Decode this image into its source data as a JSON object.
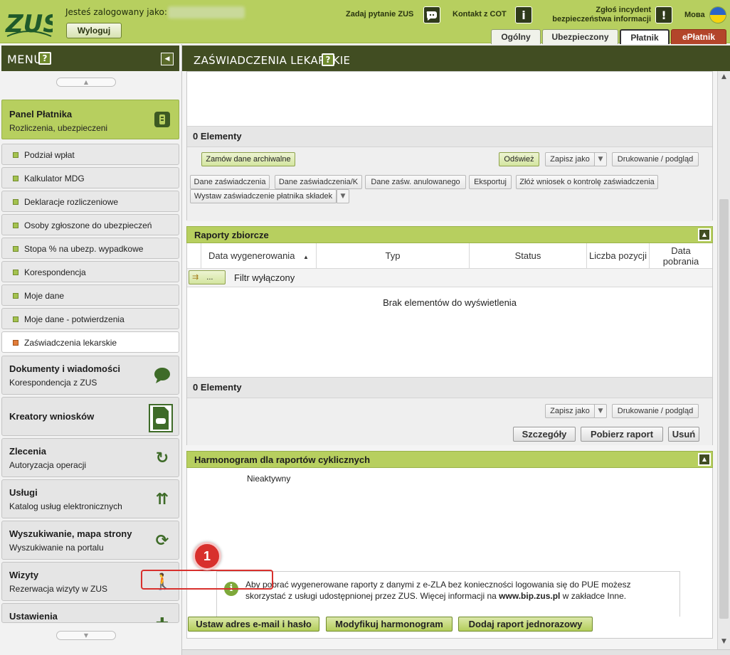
{
  "colors": {
    "accent_green": "#b7cf5f",
    "dark_header": "#414d22",
    "highlight_red": "#d8302d"
  },
  "header": {
    "logged_label": "Jesteś zalogowany jako:",
    "logout": "Wyloguj",
    "ask_zus": "Zadaj pytanie ZUS",
    "contact_cot": "Kontakt z COT",
    "incident_line1": "Zgłoś incydent",
    "incident_line2": "bezpieczeństwa informacji",
    "language": "Мова",
    "tabs": [
      "Ogólny",
      "Ubezpieczony",
      "Płatnik",
      "ePłatnik"
    ],
    "logo": "ZUS"
  },
  "sidebar": {
    "title": "MENU",
    "help": "?",
    "panel": {
      "title": "Panel Płatnika",
      "subtitle": "Rozliczenia, ubezpieczeni"
    },
    "items": [
      "Podział wpłat",
      "Kalkulator MDG",
      "Deklaracje rozliczeniowe",
      "Osoby zgłoszone do ubezpieczeń",
      "Stopa % na ubezp. wypadkowe",
      "Korespondencja",
      "Moje dane",
      "Moje dane - potwierdzenia",
      "Zaświadczenia lekarskie"
    ],
    "categories": [
      {
        "title": "Dokumenty i wiadomości",
        "subtitle": "Korespondencja z ZUS"
      },
      {
        "title": "Kreatory wniosków",
        "subtitle": ""
      },
      {
        "title": "Zlecenia",
        "subtitle": "Autoryzacja operacji"
      },
      {
        "title": "Usługi",
        "subtitle": "Katalog usług elektronicznych"
      },
      {
        "title": "Wyszukiwanie, mapa strony",
        "subtitle": "Wyszukiwanie na portalu"
      },
      {
        "title": "Wizyty",
        "subtitle": "Rezerwacja wizyty w ZUS"
      },
      {
        "title": "Ustawienia",
        "subtitle": ""
      }
    ]
  },
  "main": {
    "title": "ZAŚWIADCZENIA LEKARSKIE",
    "help": "?",
    "top": {
      "count": "0 Elementy",
      "order_archive": "Zamów dane archiwalne",
      "refresh": "Odśwież",
      "save_as": "Zapisz jako",
      "print": "Drukowanie / podgląd",
      "actions": [
        "Dane zaświadczenia",
        "Dane zaświadczenia/K",
        "Dane zaśw. anulowanego",
        "Eksportuj",
        "Złóż wniosek o kontrolę zaświadczenia",
        "Wystaw zaświadczenie płatnika składek"
      ]
    },
    "reports": {
      "title": "Raporty zbiorcze",
      "columns": [
        "Data wygenerowania",
        "Typ",
        "Status",
        "Liczba pozycji",
        "Data pobrania"
      ],
      "filter_btn": "...",
      "filter_status": "Filtr wyłączony",
      "empty": "Brak elementów do wyświetlenia",
      "count": "0 Elementy",
      "save_as": "Zapisz jako",
      "print": "Drukowanie / podgląd",
      "details": "Szczegóły",
      "download": "Pobierz raport",
      "delete": "Usuń"
    },
    "schedule": {
      "title": "Harmonogram dla raportów cyklicznych",
      "status": "Nieaktywny",
      "info_part1": "Aby pobrać wygenerowane raporty z danymi z e-ZLA bez konieczności logowania się do PUE możesz skorzystać z usługi udostępnionej przez ZUS. Więcej informacji na ",
      "info_link": "www.bip.zus.pl",
      "info_part2": " w zakładce Inne.",
      "set_email": "Ustaw adres e-mail i hasło",
      "modify": "Modyfikuj harmonogram",
      "add_single": "Dodaj raport jednorazowy",
      "step": "1"
    }
  }
}
